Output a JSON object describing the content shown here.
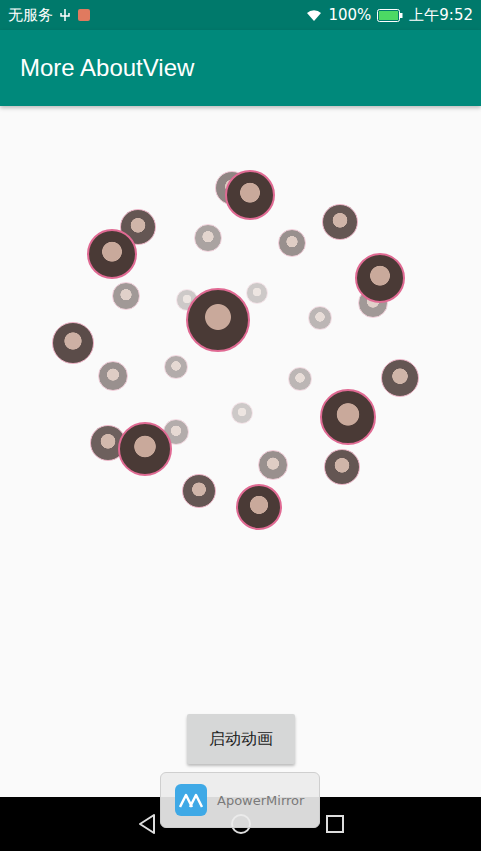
{
  "status_bar": {
    "carrier": "无服务",
    "battery": "100%",
    "time": "上午9:52"
  },
  "app_bar": {
    "title": "More AboutView"
  },
  "avatars": [
    {
      "bordered": false,
      "opacity": 0.6
    },
    {
      "bordered": true,
      "opacity": 1
    },
    {
      "bordered": false,
      "opacity": 0.85
    },
    {
      "bordered": false,
      "opacity": 0.45
    },
    {
      "bordered": false,
      "opacity": 0.55
    },
    {
      "bordered": false,
      "opacity": 0.85
    },
    {
      "bordered": true,
      "opacity": 1
    },
    {
      "bordered": false,
      "opacity": 0.5
    },
    {
      "bordered": true,
      "opacity": 1
    },
    {
      "bordered": false,
      "opacity": 0.5
    },
    {
      "bordered": false,
      "opacity": 0.25
    },
    {
      "bordered": false,
      "opacity": 0.25
    },
    {
      "bordered": true,
      "opacity": 1
    },
    {
      "bordered": false,
      "opacity": 0.35
    },
    {
      "bordered": false,
      "opacity": 0.9
    },
    {
      "bordered": false,
      "opacity": 0.4
    },
    {
      "bordered": false,
      "opacity": 0.55
    },
    {
      "bordered": false,
      "opacity": 0.35
    },
    {
      "bordered": false,
      "opacity": 0.85
    },
    {
      "bordered": false,
      "opacity": 0.25
    },
    {
      "bordered": true,
      "opacity": 1
    },
    {
      "bordered": false,
      "opacity": 0.8
    },
    {
      "bordered": false,
      "opacity": 0.4
    },
    {
      "bordered": true,
      "opacity": 1
    },
    {
      "bordered": false,
      "opacity": 0.55
    },
    {
      "bordered": false,
      "opacity": 0.85
    },
    {
      "bordered": false,
      "opacity": 0.85
    },
    {
      "bordered": true,
      "opacity": 1
    }
  ],
  "start_button": {
    "label": "启动动画"
  },
  "watermark": {
    "label": "ApowerMirror"
  }
}
